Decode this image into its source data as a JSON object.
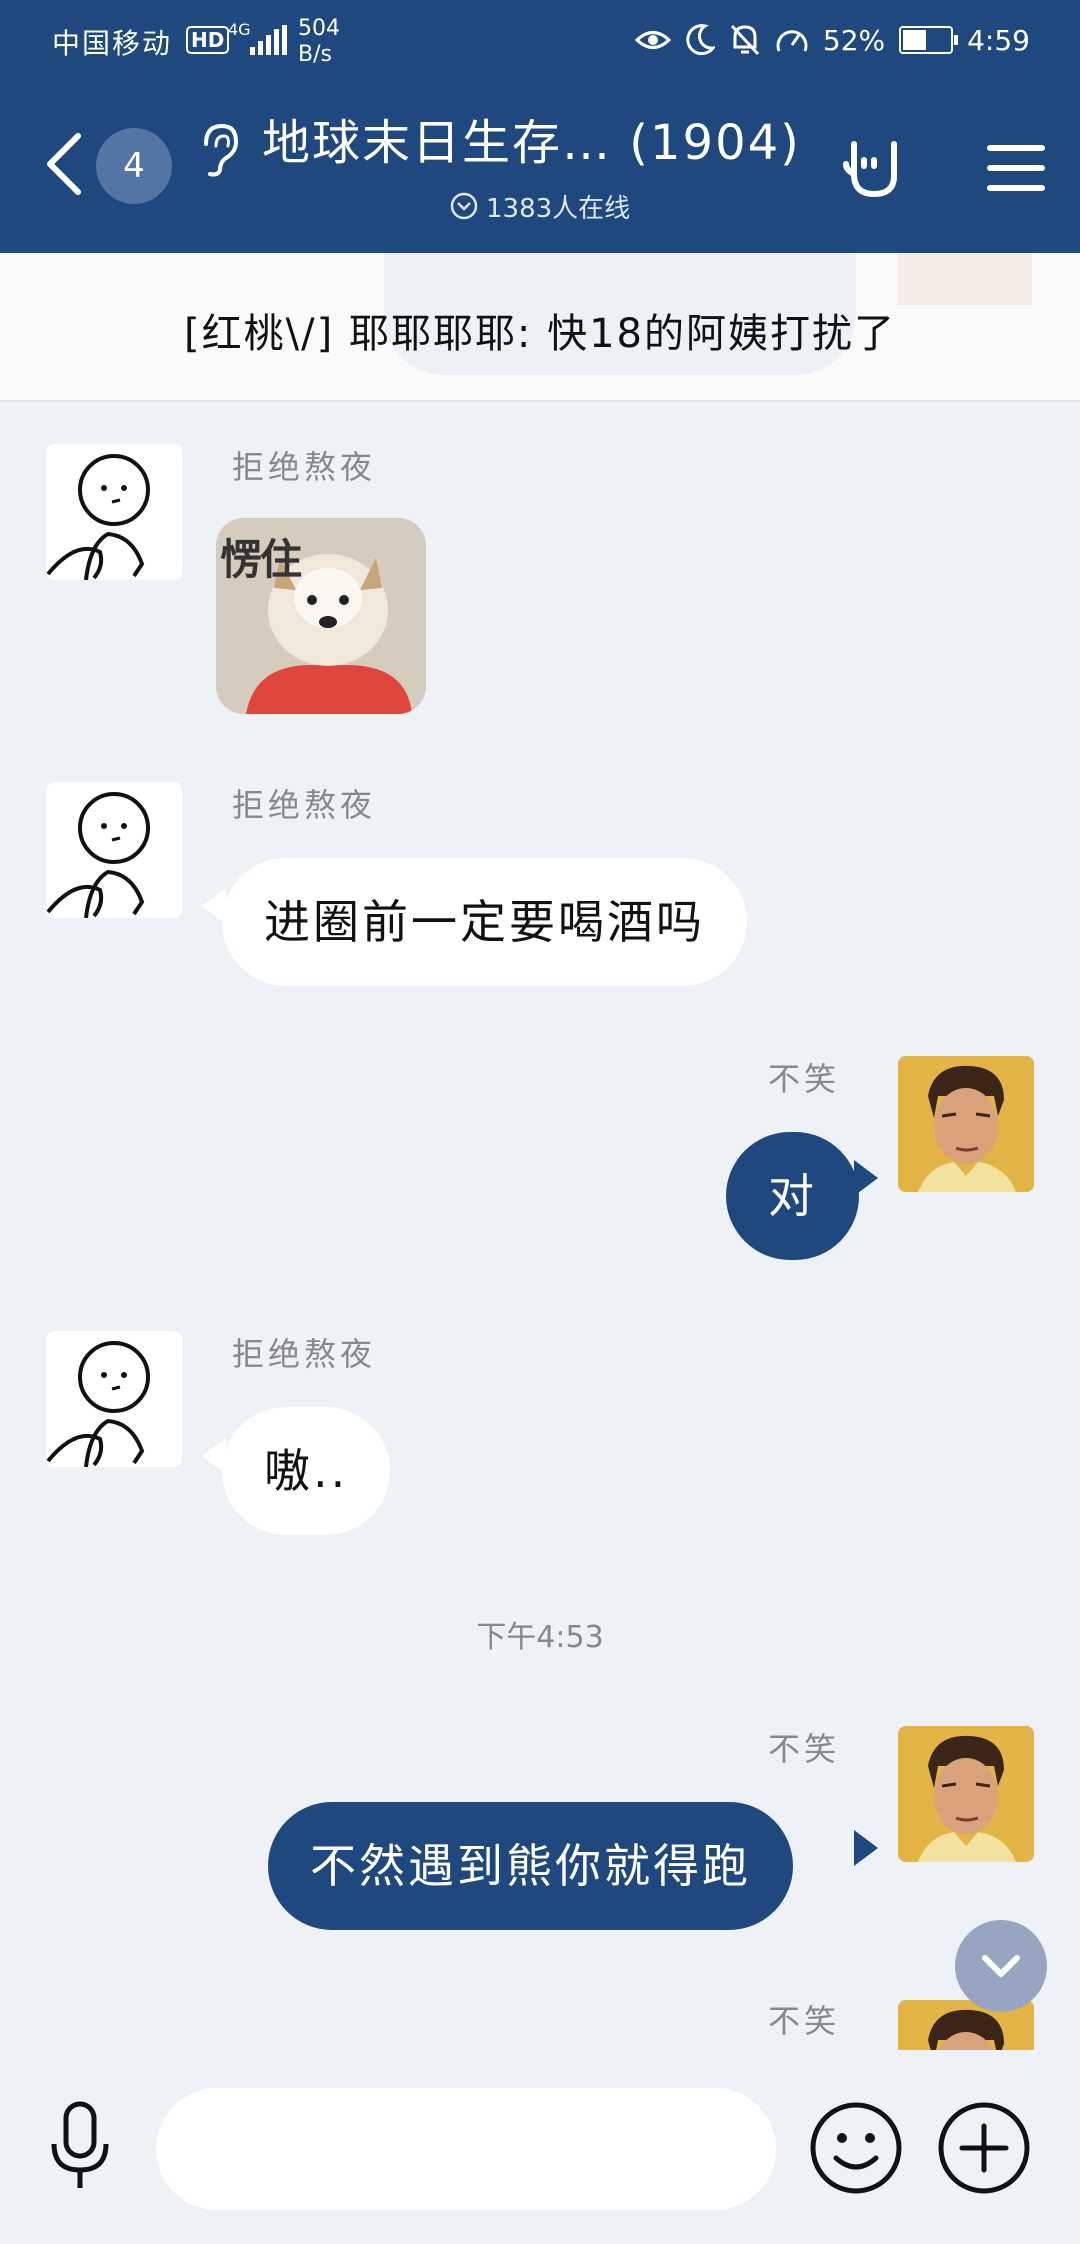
{
  "status_bar": {
    "carrier": "中国移动",
    "hd": "HD",
    "network": "4G",
    "speed_value": "504",
    "speed_unit": "B/s",
    "battery": "52%",
    "battery_level": 0.52,
    "time": "4:59",
    "icons": [
      "eye-icon",
      "moon-icon",
      "bell-off-icon",
      "speedometer-icon",
      "battery-icon"
    ]
  },
  "header": {
    "unread_count": "4",
    "title": "地球末日生存… (1904)",
    "online": "1383人在线"
  },
  "pinned": {
    "text": "[红桃\\/] 耶耶耶耶: 快18的阿姨打扰了"
  },
  "messages": [
    {
      "side": "left",
      "sender": "拒绝熬夜",
      "type": "sticker",
      "sticker_caption": "愣住"
    },
    {
      "side": "left",
      "sender": "拒绝熬夜",
      "type": "text",
      "text": "进圈前一定要喝酒吗"
    },
    {
      "side": "right",
      "sender": "不笑",
      "type": "text",
      "text": "对"
    },
    {
      "side": "left",
      "sender": "拒绝熬夜",
      "type": "text",
      "text": "嗷.."
    },
    {
      "type": "time",
      "text": "下午4:53"
    },
    {
      "side": "right",
      "sender": "不笑",
      "type": "text",
      "text": "不然遇到熊你就得跑"
    },
    {
      "side": "right",
      "sender": "不笑",
      "type": "partial"
    }
  ],
  "input": {
    "placeholder": "",
    "value": ""
  },
  "colors": {
    "brand": "#1f497e",
    "background": "#eef1f6",
    "bubble_in": "#ffffff"
  }
}
